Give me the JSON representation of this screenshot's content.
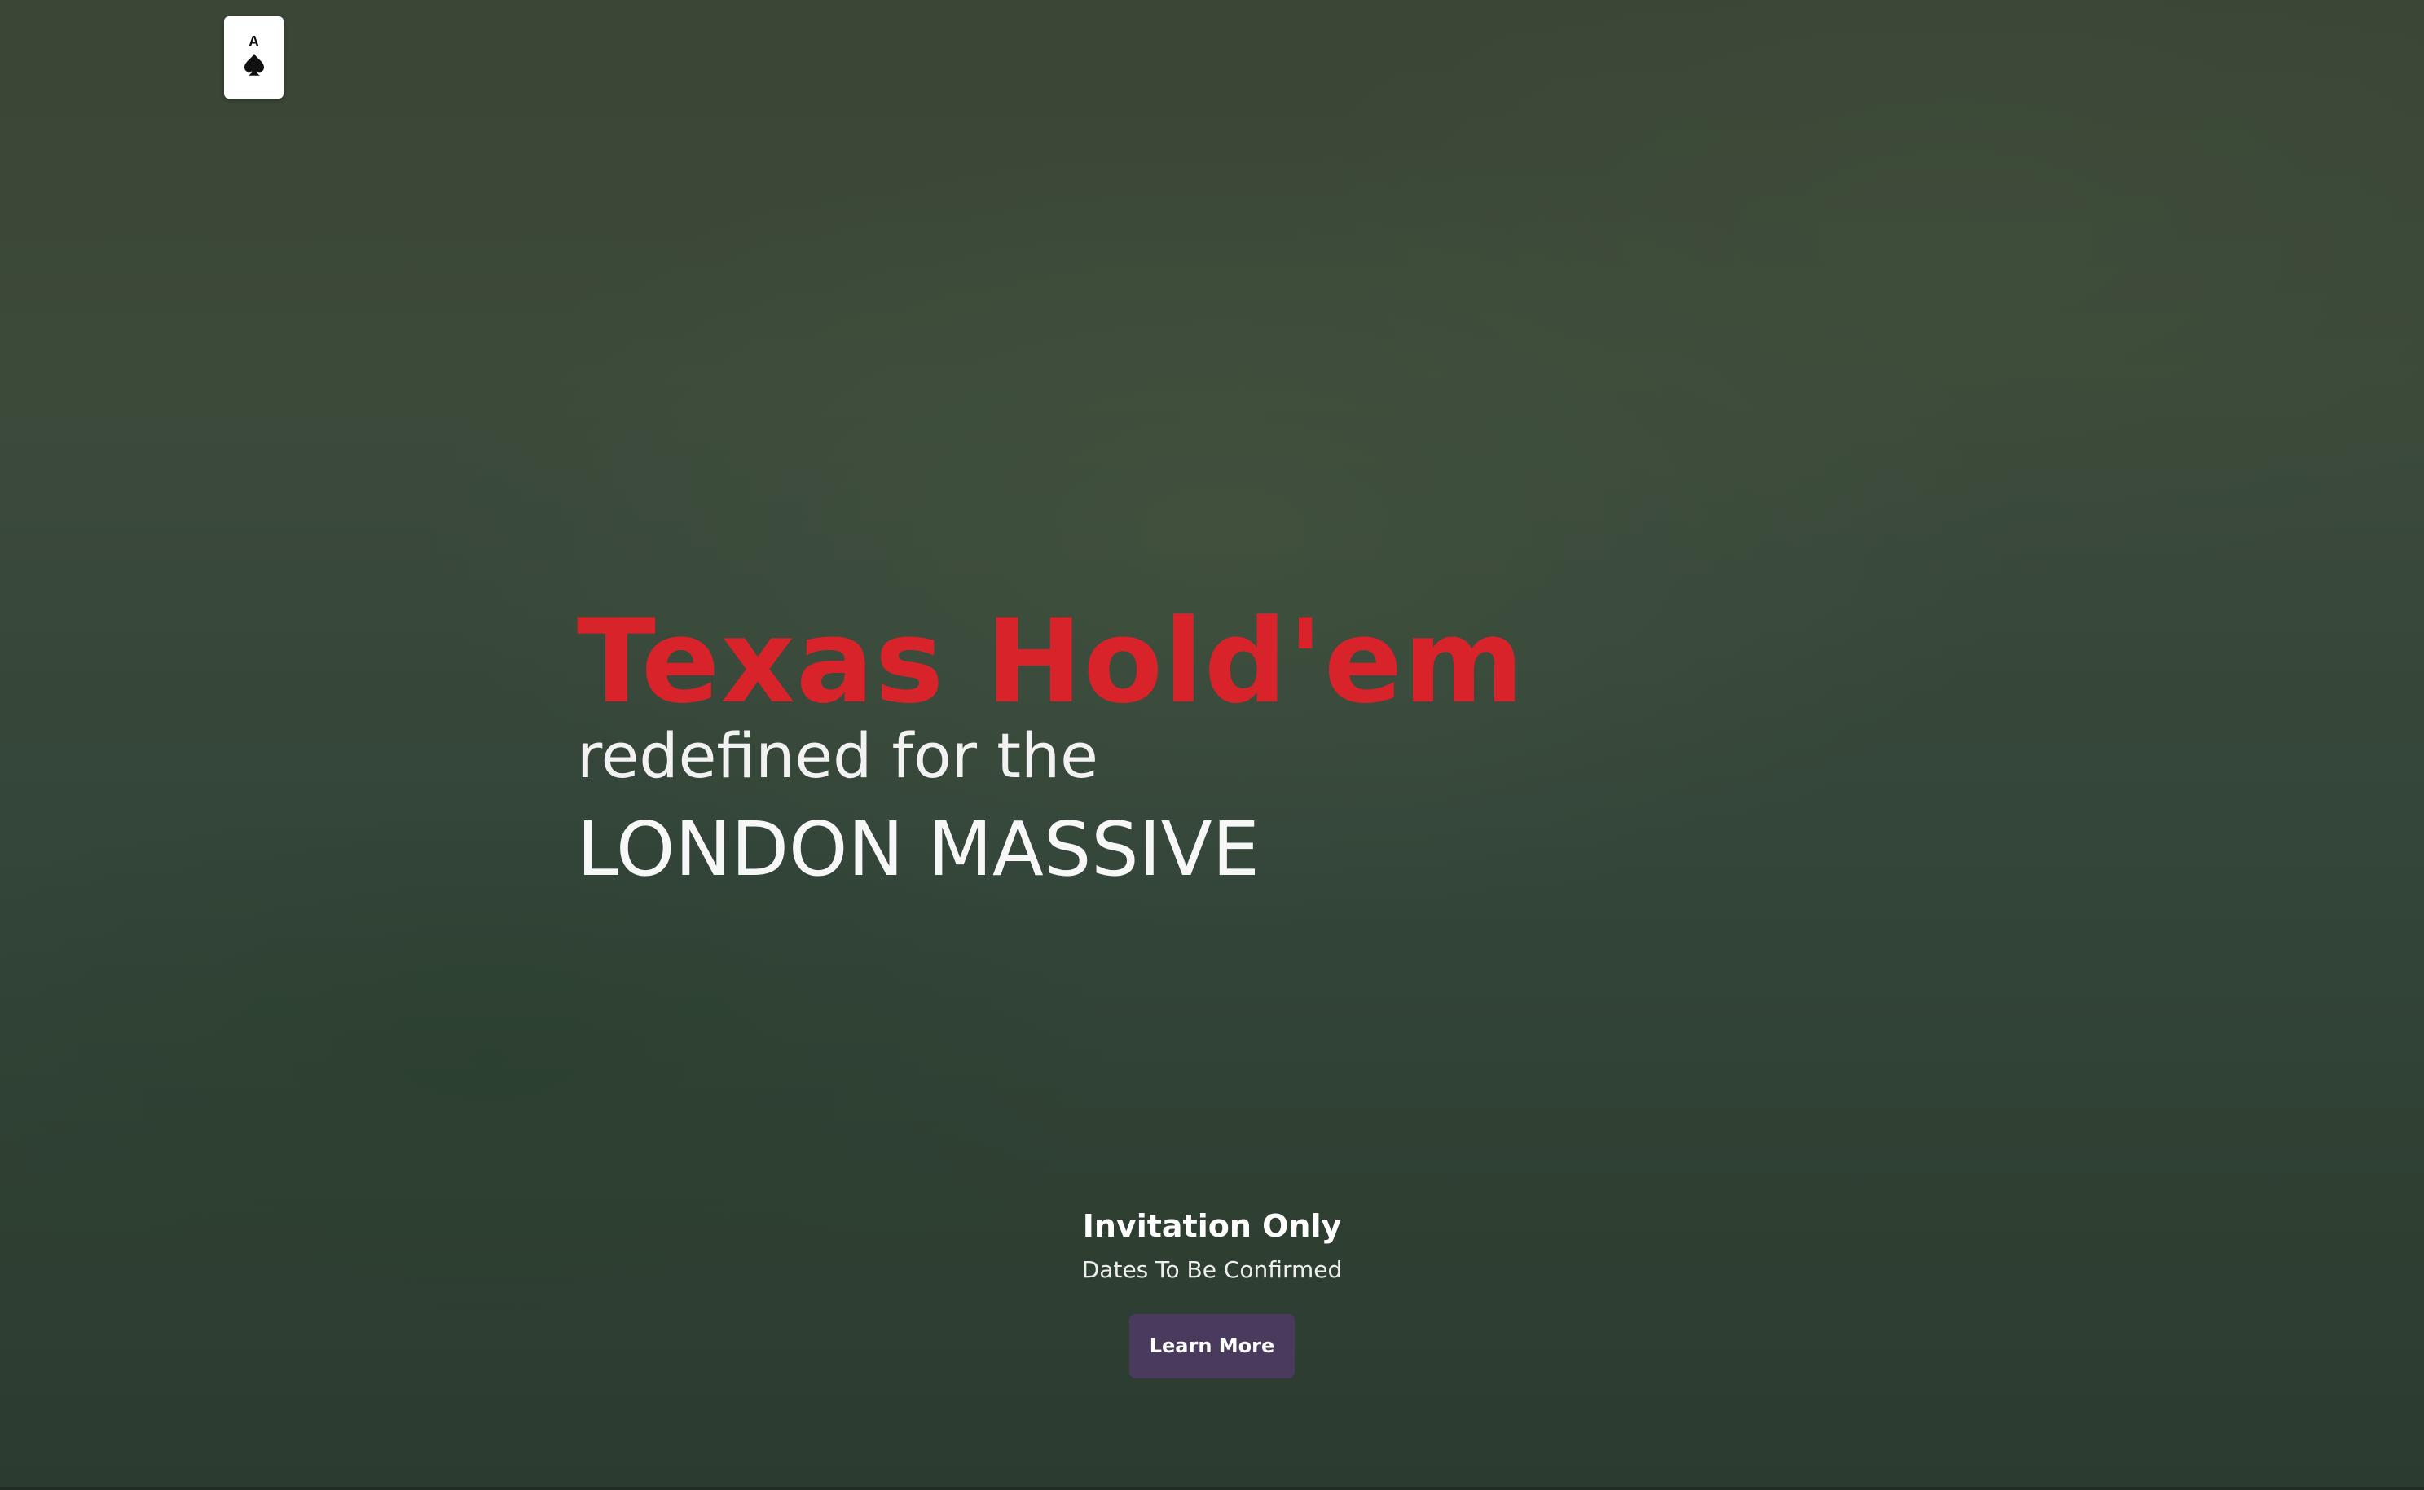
{
  "logo": {
    "rank": "A",
    "suit_icon": "spade-icon"
  },
  "hero": {
    "title": "Texas Hold'em",
    "subtitle": "redefined for the",
    "city": "LONDON MASSIVE"
  },
  "cta": {
    "heading": "Invitation Only",
    "dates": "Dates To Be Confirmed",
    "button_label": "Learn More"
  },
  "colors": {
    "background": "#3a4a3a",
    "title": "#d8232a",
    "button": "#4a3b5e",
    "text": "#ffffff"
  }
}
